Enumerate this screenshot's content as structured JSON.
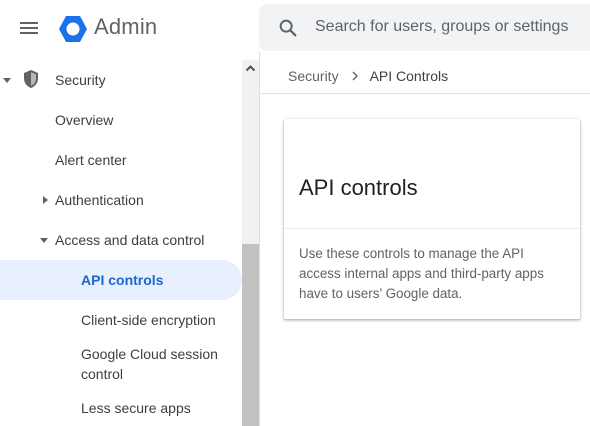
{
  "header": {
    "brand": "Admin",
    "search_placeholder": "Search for users, groups or settings"
  },
  "sidebar": {
    "section": "Security",
    "items": [
      {
        "label": "Overview"
      },
      {
        "label": "Alert center"
      },
      {
        "label": "Authentication"
      },
      {
        "label": "Access and data control"
      },
      {
        "label": "API controls",
        "active": true
      },
      {
        "label": "Client-side encryption"
      },
      {
        "label": "Google Cloud session control"
      },
      {
        "label": "Less secure apps"
      }
    ]
  },
  "breadcrumb": {
    "parent": "Security",
    "current": "API Controls"
  },
  "card": {
    "title": "API controls",
    "description": "Use these controls to manage the API access internal apps and third-party apps have to users’ Google data."
  },
  "colors": {
    "accent": "#1a73e8",
    "active_bg": "#e8f0fe",
    "active_text": "#1967d2"
  }
}
